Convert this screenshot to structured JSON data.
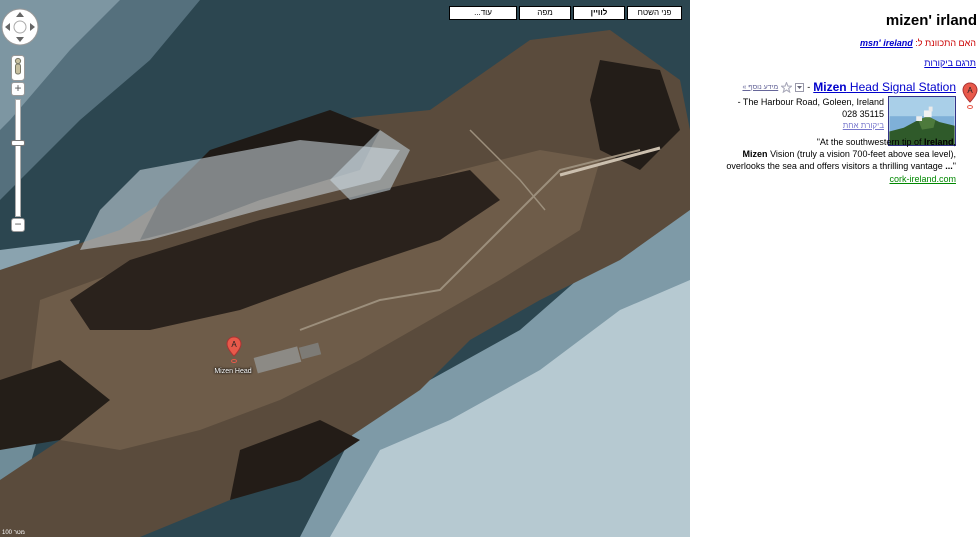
{
  "map": {
    "type_buttons": [
      {
        "label": "...עוד",
        "active": false,
        "width": 68
      },
      {
        "label": "מפה",
        "active": false,
        "width": 52
      },
      {
        "label": "לוויין",
        "active": true,
        "width": 52
      },
      {
        "label": "פני השטח",
        "active": false,
        "width": 55
      }
    ],
    "zoom_in_label": "+",
    "zoom_out_label": "−",
    "marker": {
      "letter": "A",
      "label": "Mizen Head",
      "color": "#e8594a"
    },
    "scale_text": "100 מטר"
  },
  "sidebar": {
    "query": "mizen' irland",
    "did_you_mean_prefix": "האם התכוונת ל:",
    "did_you_mean_suggestion": "msn' ireland",
    "translate_reviews": "תרגם ביקורות",
    "result": {
      "letter": "A",
      "name_bold": "Mizen",
      "name_rest": " Head Signal Station",
      "dash": "-",
      "more_info": "מידע נוסף »",
      "address": "- The Harbour Road, Goleen, Ireland",
      "phone": "028 35115",
      "reviews": "ביקורת אחת",
      "snippet_1": "\"At the southwestern tip of ",
      "snippet_1b": "Ireland",
      "snippet_1c": ",",
      "snippet_2b": "Mizen",
      "snippet_2": " Vision (truly a vision 700-feet above sea level),",
      "snippet_3": "overlooks the sea and offers visitors a thrilling vantage ",
      "snippet_3b": "...",
      "snippet_3c": "\"",
      "source": "cork-ireland.com"
    }
  },
  "colors": {
    "link": "#0000cc",
    "suggestion_red": "#cc0000",
    "source_green": "#008000",
    "marker_red": "#e8594a"
  }
}
